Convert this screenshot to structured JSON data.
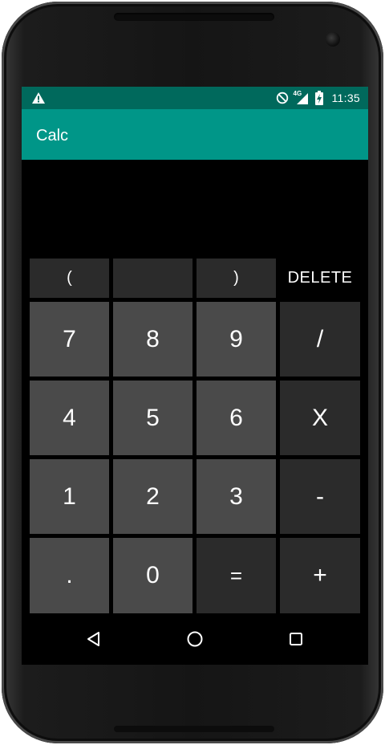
{
  "status_bar": {
    "time": "11:35",
    "network_label": "4G",
    "icons": [
      "warning-icon",
      "do-not-disturb-icon",
      "signal-icon",
      "battery-charging-icon"
    ]
  },
  "app_bar": {
    "title": "Calc"
  },
  "display": {
    "expression": ""
  },
  "keypad": {
    "top_row": [
      "(",
      "",
      ")",
      "DELETE"
    ],
    "rows": [
      [
        "7",
        "8",
        "9",
        "/"
      ],
      [
        "4",
        "5",
        "6",
        "X"
      ],
      [
        "1",
        "2",
        "3",
        "-"
      ],
      [
        ".",
        "0",
        "=",
        "+"
      ]
    ]
  },
  "nav_bar": {
    "icons": [
      "back-icon",
      "home-icon",
      "recents-icon"
    ]
  },
  "colors": {
    "status_bar": "#00695c",
    "app_bar": "#009688",
    "number_key": "#4a4a4a",
    "operator_key": "#2b2b2b",
    "background": "#000000"
  }
}
